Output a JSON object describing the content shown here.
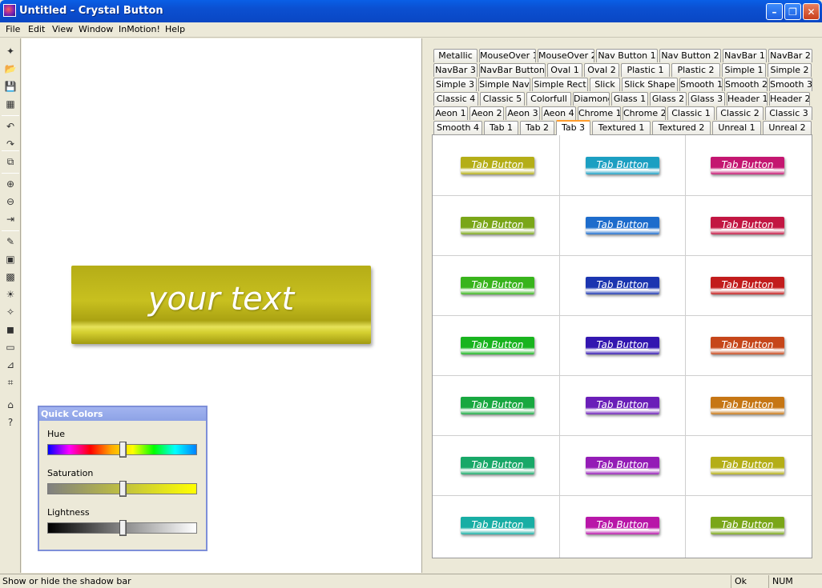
{
  "window": {
    "title": "Untitled - Crystal Button"
  },
  "menu": [
    "File",
    "Edit",
    "View",
    "Window",
    "InMotion!",
    "Help"
  ],
  "toolbar_icons": [
    "new-button-icon",
    "open-icon",
    "save-icon",
    "publish-icon",
    "undo-icon",
    "redo-icon",
    "copy-icon",
    "zoom-in-icon",
    "zoom-out-icon",
    "align-icon",
    "pencil-icon",
    "image-icon",
    "pattern-icon",
    "light-icon",
    "effect-icon",
    "shadow-icon",
    "frame-icon",
    "ruler-icon",
    "crop-icon",
    "home-icon",
    "help-icon"
  ],
  "preview": {
    "text": "your text"
  },
  "quick_colors": {
    "title": "Quick Colors",
    "hue_label": "Hue",
    "saturation_label": "Saturation",
    "lightness_label": "Lightness",
    "hue": 0.5,
    "saturation": 0.5,
    "lightness": 0.5
  },
  "tabs": [
    [
      "Metallic",
      "MouseOver 1",
      "MouseOver 2",
      "Nav Button 1",
      "Nav Button 2",
      "NavBar 1",
      "NavBar 2"
    ],
    [
      "NavBar 3",
      "NavBar Button",
      "Oval 1",
      "Oval 2",
      "Plastic 1",
      "Plastic 2",
      "Simple 1",
      "Simple 2"
    ],
    [
      "Simple 3",
      "Simple Nav",
      "Simple Rect",
      "Slick",
      "Slick Shape",
      "Smooth 1",
      "Smooth 2",
      "Smooth 3"
    ],
    [
      "Classic 4",
      "Classic 5",
      "Colorfull",
      "Diamond",
      "Glass 1",
      "Glass 2",
      "Glass 3",
      "Header 1",
      "Header 2"
    ],
    [
      "Aeon 1",
      "Aeon 2",
      "Aeon 3",
      "Aeon 4",
      "Chrome 1",
      "Chrome 2",
      "Classic 1",
      "Classic 2",
      "Classic 3"
    ],
    [
      "Smooth 4",
      "Tab 1",
      "Tab 2",
      "Tab 3",
      "Textured 1",
      "Textured 2",
      "Unreal 1",
      "Unreal 2"
    ]
  ],
  "active_tab": "Tab 3",
  "samples": {
    "label": "Tab Button",
    "colors": [
      [
        "#b4ae17",
        "#1c9fc2",
        "#c41670"
      ],
      [
        "#7aa618",
        "#1d6ccc",
        "#c21642"
      ],
      [
        "#38b41c",
        "#1b35b0",
        "#c21c1c"
      ],
      [
        "#18b41e",
        "#3316b0",
        "#c6461a"
      ],
      [
        "#18a840",
        "#6a1eb8",
        "#c67614"
      ],
      [
        "#18a868",
        "#941cb6",
        "#b4ae17"
      ],
      [
        "#18aea4",
        "#b816a8",
        "#7aa618"
      ]
    ]
  },
  "status": {
    "message": "Show or hide the shadow bar",
    "ok": "Ok",
    "num": "NUM"
  }
}
